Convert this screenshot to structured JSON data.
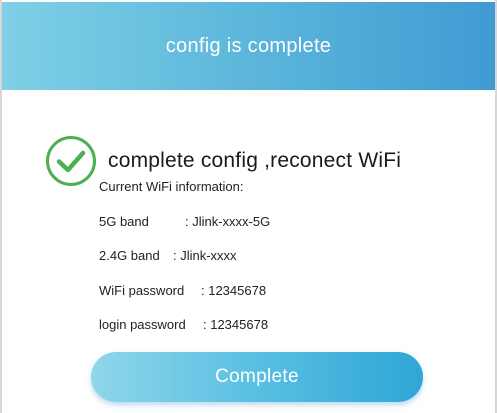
{
  "header": {
    "title": "config is complete"
  },
  "status": {
    "icon": "check-circle-icon",
    "text": "complete config ,reconect WiFi",
    "icon_color": "#4caf50"
  },
  "wifi_info": {
    "heading": "Current WiFi information:",
    "band_5g": {
      "label": "5G band",
      "value": ": Jlink-xxxx-5G"
    },
    "band_24g": {
      "label": "2.4G band",
      "value": ": Jlink-xxxx"
    },
    "wifi_password": {
      "label": "WiFi password",
      "value": ": 12345678"
    },
    "login_password": {
      "label": "login password",
      "value": ": 12345678"
    }
  },
  "actions": {
    "complete_label": "Complete"
  },
  "colors": {
    "header_start": "#7fd0e6",
    "header_end": "#3f9bd3",
    "button_start": "#8fd6ea",
    "button_end": "#2fa6d6"
  }
}
